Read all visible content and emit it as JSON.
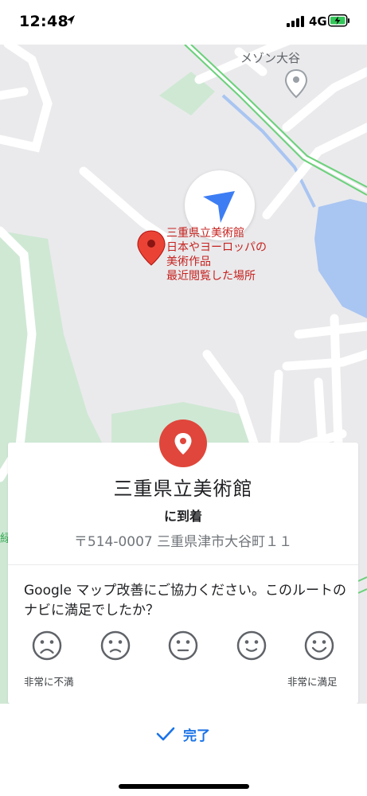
{
  "status_bar": {
    "time": "12:48",
    "network": "4G"
  },
  "map": {
    "poi_name": "メゾン大谷",
    "place_label_lines": [
      "三重県立美術館",
      "日本やヨーロッパの",
      "美術作品",
      "最近閲覧した場所"
    ],
    "edge_label": "緑"
  },
  "card": {
    "title": "三重県立美術館",
    "subtitle": "に到着",
    "address": "〒514-0007 三重県津市大谷町１１",
    "question": "Google マップ改善にご協力ください。このルートのナビに満足でしたか？",
    "rating_low_label": "非常に不満",
    "rating_high_label": "非常に満足"
  },
  "footer": {
    "done_label": "完了"
  },
  "colors": {
    "accent_blue": "#1a73e8",
    "pin_red": "#e0463b",
    "place_label_red": "#c5221f",
    "water": "#a9c5f2",
    "park": "#cfe8d4",
    "road_green": "#6ad27a"
  }
}
